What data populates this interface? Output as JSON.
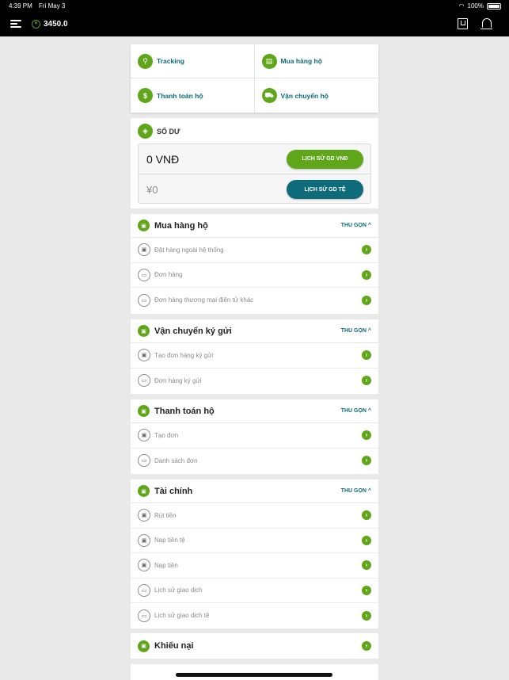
{
  "status": {
    "time": "4:39 PM",
    "date": "Fri May 3",
    "battery": "100%",
    "battery_level": 1.0
  },
  "header": {
    "balance": "3450.0",
    "coin_symbol": "¥"
  },
  "quick_actions": [
    {
      "label": "Tracking",
      "icon": "search-icon",
      "glyph": "⚲"
    },
    {
      "label": "Mua hàng hộ",
      "icon": "calendar-icon",
      "glyph": "▤"
    },
    {
      "label": "Thanh toán hộ",
      "icon": "dollar-icon",
      "glyph": "$"
    },
    {
      "label": "Vận chuyển hộ",
      "icon": "truck-icon",
      "glyph": "⛟"
    }
  ],
  "wallet": {
    "title": "SỐ DƯ",
    "vnd_amount": "0 VNĐ",
    "cny_amount": "¥0",
    "vnd_button": "LỊCH SỬ GD VNĐ",
    "cny_button": "LỊCH SỬ GD TỆ"
  },
  "collapse_label": "THU GỌN",
  "sections": [
    {
      "title": "Mua hàng hộ",
      "items": [
        "Đặt hàng ngoài hệ thống",
        "Đơn hàng",
        "Đơn hàng thương mại điện tử khác"
      ]
    },
    {
      "title": "Vận chuyển ký gửi",
      "items": [
        "Tạo đơn hàng ký gửi",
        "Đơn hàng ký gửi"
      ]
    },
    {
      "title": "Thanh toán hộ",
      "items": [
        "Tạo đơn",
        "Danh sách đơn"
      ]
    },
    {
      "title": "Tài chính",
      "items": [
        "Rút tiền",
        "Nạp tiền tệ",
        "Nạp tiền",
        "Lịch sử giao dịch",
        "Lịch sử giao dịch tệ"
      ]
    },
    {
      "title": "Khiếu nại",
      "items": []
    }
  ],
  "colors": {
    "green": "#5fa61a",
    "teal": "#0e6b79"
  }
}
